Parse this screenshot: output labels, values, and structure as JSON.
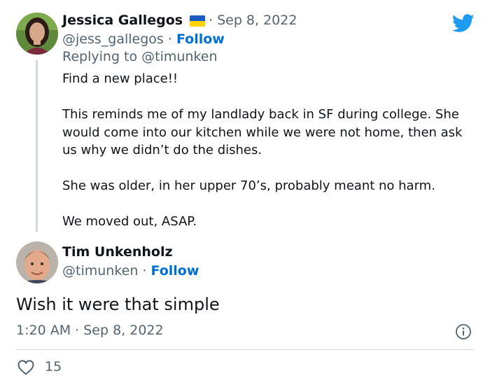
{
  "reply_tweet": {
    "author_name": "Jessica Gallegos",
    "date": "· Sep 8, 2022",
    "handle": "@jess_gallegos",
    "separator": " · ",
    "follow_label": "Follow",
    "replying_to": "Replying to @timunken",
    "paragraphs": [
      "Find a new place!!",
      "This reminds me of my landlady back in SF during college. She would come into our kitchen while we were not home, then ask us why we didn’t do the dishes.",
      "She was older, in her upper 70’s, probably meant no harm.",
      "We moved out, ASAP."
    ],
    "flag_icon": "ukraine-flag-icon"
  },
  "main_tweet": {
    "author_name": "Tim Unkenholz",
    "handle": "@timunken",
    "separator": " · ",
    "follow_label": "Follow",
    "text": "Wish it were that simple",
    "timestamp": "1:20 AM · Sep 8, 2022",
    "like_count": "15"
  },
  "icons": {
    "brand": "twitter-bird-icon",
    "info": "info-icon",
    "like": "heart-icon"
  },
  "colors": {
    "brand_blue": "#1d9bf0",
    "link_blue": "#006fd6",
    "text_primary": "#0f1419",
    "text_secondary": "#536471",
    "divider": "#cfd9de"
  }
}
